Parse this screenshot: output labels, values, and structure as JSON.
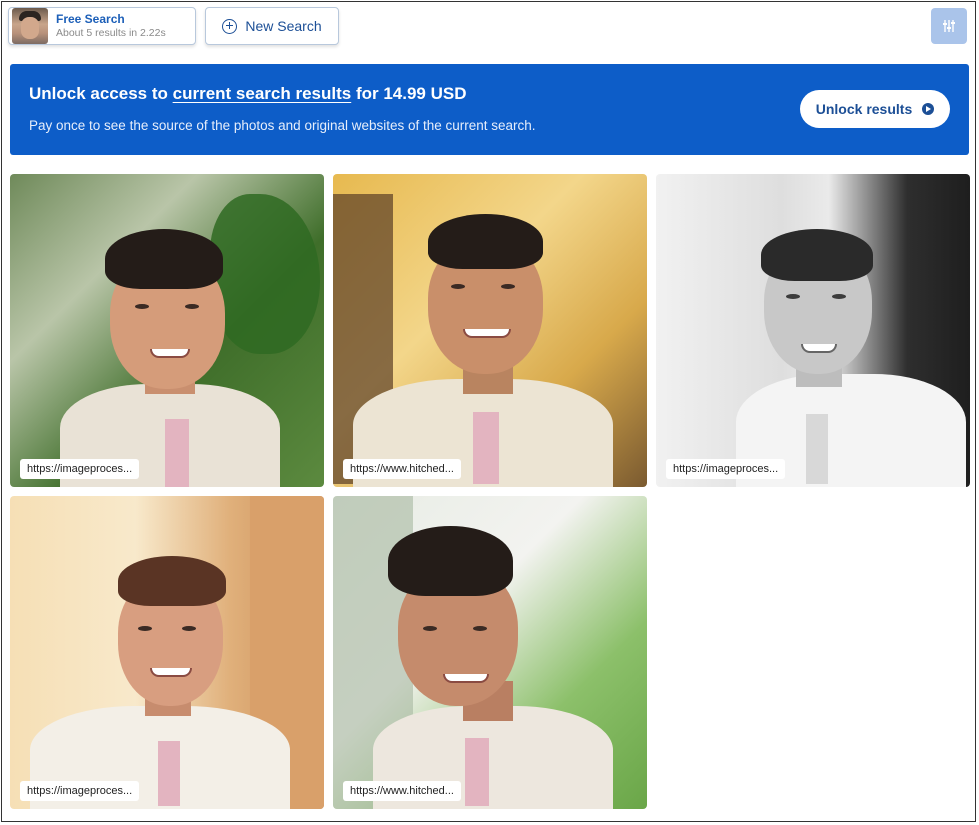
{
  "header": {
    "search_title": "Free Search",
    "search_subtitle": "About 5 results in 2.22s",
    "new_search_label": "New Search",
    "filter_icon": "filter-sliders-icon"
  },
  "banner": {
    "title_prefix": "Unlock access to ",
    "title_link": "current search results",
    "title_suffix": " for 14.99 USD",
    "subtitle": "Pay once to see the source of the photos and original websites of the current search.",
    "button_label": "Unlock results",
    "button_icon": "arrow-circle-icon"
  },
  "results": [
    {
      "url": "https://imageproces..."
    },
    {
      "url": "https://www.hitched..."
    },
    {
      "url": "https://imageproces..."
    },
    {
      "url": "https://imageproces..."
    },
    {
      "url": "https://www.hitched..."
    }
  ],
  "colors": {
    "brand_blue": "#0d5dc8",
    "link_blue": "#1c5fb8",
    "filter_button": "#aac4ea"
  }
}
